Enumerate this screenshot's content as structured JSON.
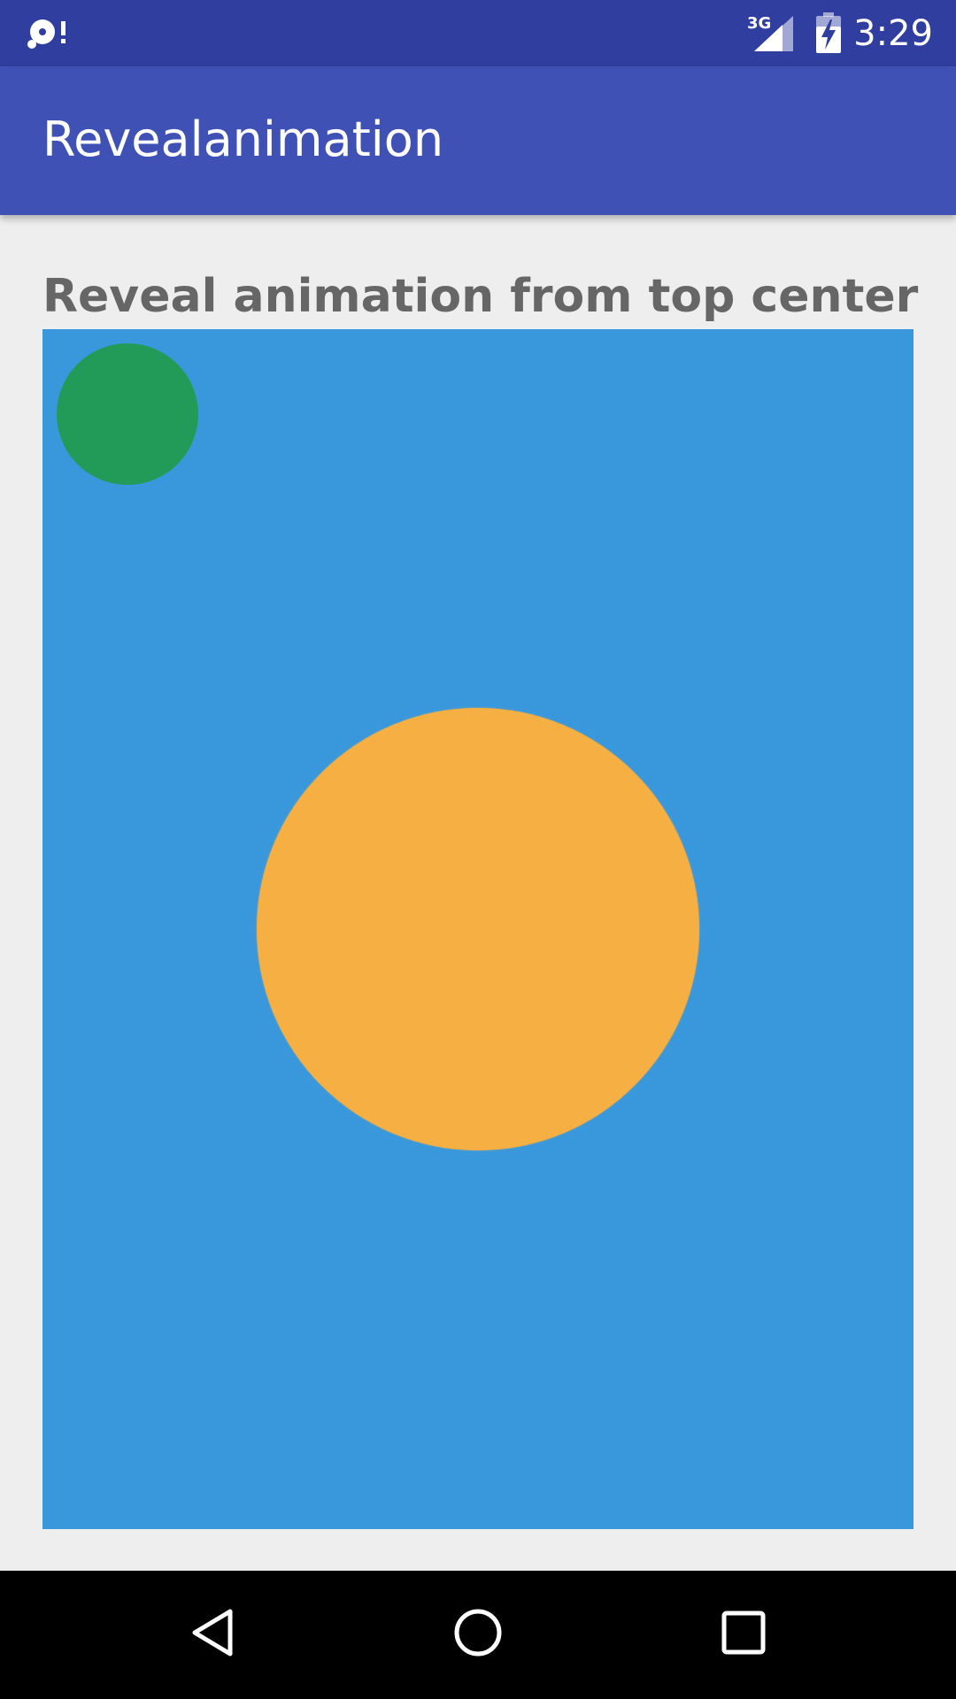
{
  "status_bar": {
    "time": "3:29",
    "network_label": "3G",
    "left_icon": "sync-alert-icon",
    "signal_icon": "cell-signal-icon",
    "battery_icon": "battery-charging-icon"
  },
  "app_bar": {
    "title": "Revealanimation"
  },
  "main": {
    "heading": "Reveal animation from top center",
    "panel_color": "#3998dc",
    "small_circle_color": "#239b58",
    "large_circle_color": "#f5af42"
  },
  "nav_bar": {
    "back_icon": "back-icon",
    "home_icon": "home-icon",
    "recents_icon": "recents-icon"
  },
  "colors": {
    "status_bar": "#303f9f",
    "app_bar": "#3f51b5",
    "background": "#eeeeee"
  }
}
